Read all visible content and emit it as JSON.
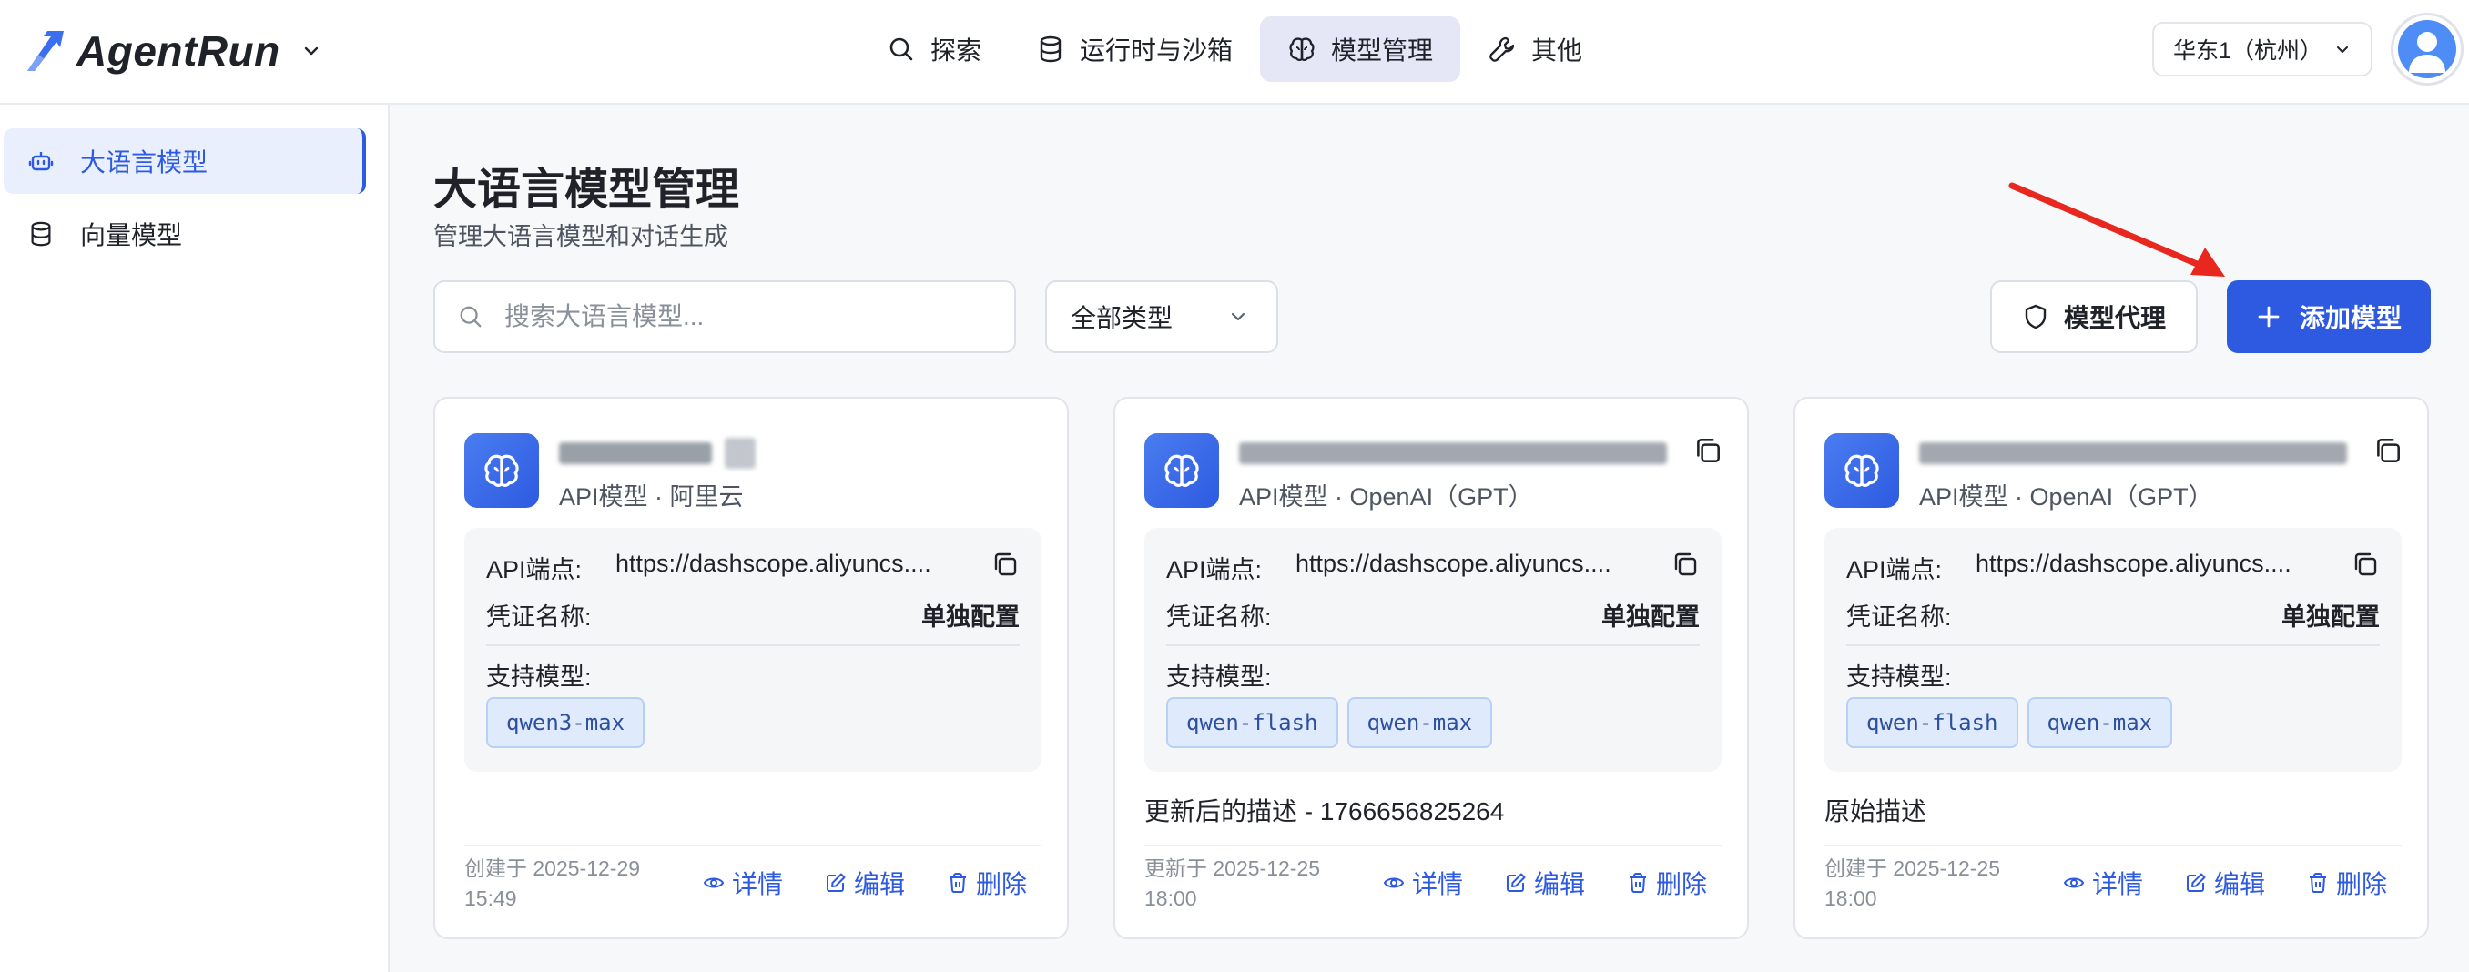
{
  "app": {
    "name": "AgentRun"
  },
  "nav": [
    {
      "label": "探索",
      "icon": "search-icon"
    },
    {
      "label": "运行时与沙箱",
      "icon": "database-icon"
    },
    {
      "label": "模型管理",
      "icon": "brain-icon",
      "active": true
    },
    {
      "label": "其他",
      "icon": "wrench-icon"
    }
  ],
  "region": {
    "label": "华东1（杭州）"
  },
  "sidebar": {
    "items": [
      {
        "label": "大语言模型",
        "icon": "bot-icon",
        "active": true
      },
      {
        "label": "向量模型",
        "icon": "database-icon"
      }
    ]
  },
  "page": {
    "title": "大语言模型管理",
    "subtitle": "管理大语言模型和对话生成"
  },
  "toolbar": {
    "search_placeholder": "搜索大语言模型...",
    "type_filter": "全部类型",
    "proxy_label": "模型代理",
    "add_label": "添加模型"
  },
  "labels": {
    "endpoint": "API端点:",
    "credential": "凭证名称:",
    "models": "支持模型:",
    "details": "详情",
    "edit": "编辑",
    "delete": "删除"
  },
  "cards": [
    {
      "name_obscured": true,
      "subtitle": "API模型 · 阿里云",
      "endpoint": "https://dashscope.aliyuncs....",
      "credential": "单独配置",
      "models": [
        "qwen3-max"
      ],
      "description": "",
      "time": "创建于 2025-12-29 15:49"
    },
    {
      "name_obscured": true,
      "subtitle": "API模型 · OpenAI（GPT）",
      "endpoint": "https://dashscope.aliyuncs....",
      "credential": "单独配置",
      "models": [
        "qwen-flash",
        "qwen-max"
      ],
      "description": "更新后的描述 - 1766656825264",
      "time": "更新于 2025-12-25 18:00"
    },
    {
      "name_obscured": true,
      "subtitle": "API模型 · OpenAI（GPT）",
      "endpoint": "https://dashscope.aliyuncs....",
      "credential": "单独配置",
      "models": [
        "qwen-flash",
        "qwen-max"
      ],
      "description": "原始描述",
      "time": "创建于 2025-12-25 18:00"
    }
  ],
  "colors": {
    "accent": "#2d5ae0",
    "annotation_arrow": "#e8281e",
    "tag_bg": "#dfeafc"
  }
}
